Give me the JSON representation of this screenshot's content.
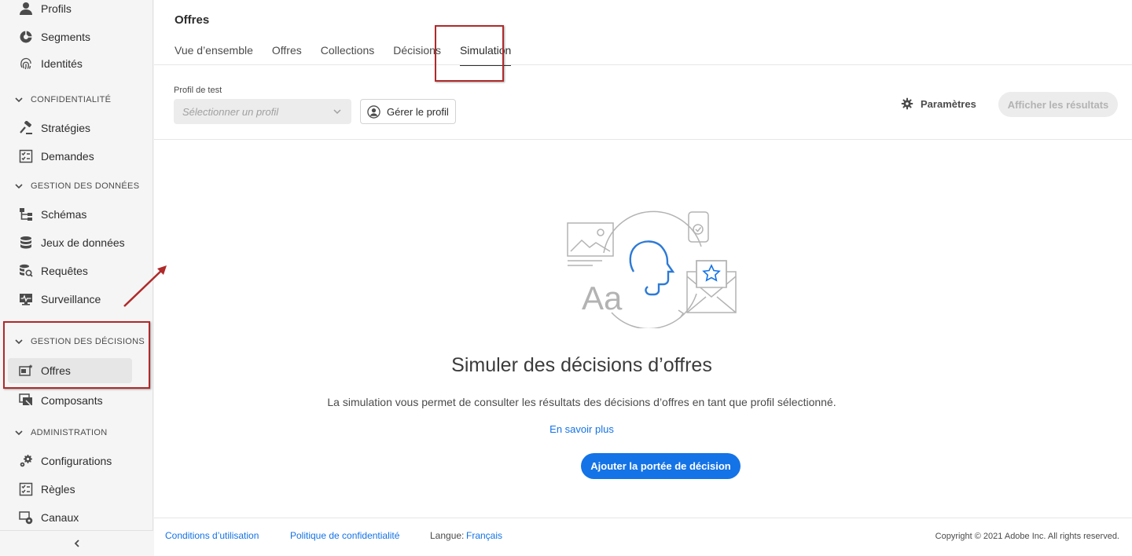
{
  "sidebar": {
    "items_top": [
      {
        "label": "Profils",
        "icon": "person-icon"
      },
      {
        "label": "Segments",
        "icon": "segments-icon"
      },
      {
        "label": "Identités",
        "icon": "fingerprint-icon"
      }
    ],
    "sections": [
      {
        "title": "CONFIDENTIALITÉ",
        "items": [
          {
            "label": "Stratégies",
            "icon": "gavel-icon"
          },
          {
            "label": "Demandes",
            "icon": "checklist-icon"
          }
        ]
      },
      {
        "title": "GESTION DES DONNÉES",
        "items": [
          {
            "label": "Schémas",
            "icon": "schema-icon"
          },
          {
            "label": "Jeux de données",
            "icon": "database-icon"
          },
          {
            "label": "Requêtes",
            "icon": "query-icon"
          },
          {
            "label": "Surveillance",
            "icon": "monitor-icon"
          }
        ]
      },
      {
        "title": "GESTION DES DÉCISIONS",
        "items": [
          {
            "label": "Offres",
            "icon": "offers-icon",
            "active": true
          },
          {
            "label": "Composants",
            "icon": "components-icon"
          }
        ]
      },
      {
        "title": "ADMINISTRATION",
        "items": [
          {
            "label": "Configurations",
            "icon": "gears-icon"
          },
          {
            "label": "Règles",
            "icon": "rules-icon"
          },
          {
            "label": "Canaux",
            "icon": "channels-icon"
          }
        ]
      }
    ]
  },
  "header": {
    "title": "Offres",
    "tabs": [
      {
        "label": "Vue d’ensemble"
      },
      {
        "label": "Offres"
      },
      {
        "label": "Collections"
      },
      {
        "label": "Décisions"
      },
      {
        "label": "Simulation",
        "selected": true
      }
    ]
  },
  "toolbar": {
    "profile_label": "Profil de test",
    "profile_placeholder": "Sélectionner un profil",
    "manage_profile": "Gérer le profil",
    "settings": "Paramètres",
    "show_results": "Afficher les résultats"
  },
  "empty_state": {
    "title": "Simuler des décisions d’offres",
    "description": "La simulation vous permet de consulter les résultats des décisions d’offres en tant que profil sélectionné.",
    "learn_more": "En savoir plus",
    "cta": "Ajouter la portée de décision"
  },
  "footer": {
    "terms": "Conditions d’utilisation",
    "privacy": "Politique de confidentialité",
    "language_label": "Langue:",
    "language_value": "Français",
    "copyright": "Copyright © 2021 Adobe Inc. All rights reserved."
  },
  "colors": {
    "accent": "#1473e6",
    "annotation": "#b02a2a"
  }
}
